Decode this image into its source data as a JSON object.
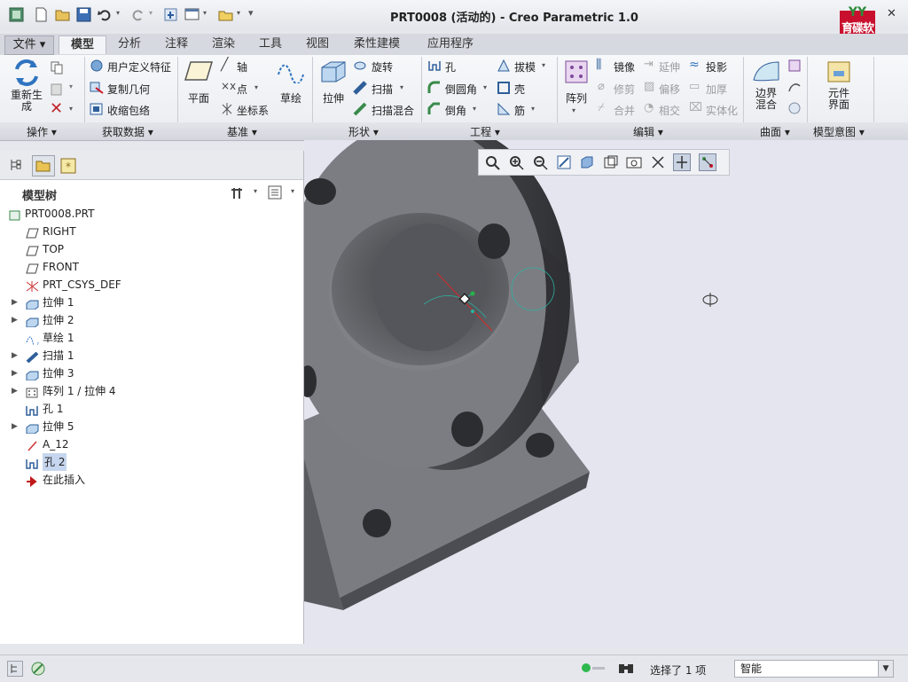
{
  "window": {
    "title": "PRT0008 (活动的) - Creo Parametric 1.0",
    "logo_text": "育碟软件",
    "help_icon": "help-icon"
  },
  "quick_access": [
    "new-file-icon",
    "open-folder-icon",
    "save-icon",
    "undo-icon",
    "redo-icon",
    "regenerate-icon",
    "window-icon",
    "folder-icon",
    "customize-icon"
  ],
  "tabs": [
    {
      "label": "文件",
      "has_menu": true
    },
    {
      "label": "模型",
      "active": true
    },
    {
      "label": "分析"
    },
    {
      "label": "注释"
    },
    {
      "label": "渲染"
    },
    {
      "label": "工具"
    },
    {
      "label": "视图"
    },
    {
      "label": "柔性建模"
    },
    {
      "label": "应用程序"
    }
  ],
  "ribbon": {
    "operations": {
      "regen": "重新生成",
      "group": "操作"
    },
    "get_data": {
      "udf": "用户定义特征",
      "copy_geom": "复制几何",
      "shrinkwrap": "收缩包络",
      "group": "获取数据"
    },
    "datum": {
      "plane": "平面",
      "axis": "轴",
      "point": "点",
      "csys": "坐标系",
      "group": "基准"
    },
    "shapes": {
      "sketch": "草绘",
      "extrude": "拉伸",
      "revolve": "旋转",
      "sweep": "扫描",
      "swept_blend": "扫描混合",
      "group": "形状"
    },
    "engineering": {
      "hole": "孔",
      "round": "倒圆角",
      "chamfer": "倒角",
      "draft": "拔模",
      "shell": "壳",
      "rib": "筋",
      "group": "工程"
    },
    "editing": {
      "pattern": "阵列",
      "mirror": "镜像",
      "trim": "修剪",
      "merge": "合并",
      "extend": "延伸",
      "offset": "偏移",
      "intersect": "相交",
      "project": "投影",
      "thicken": "加厚",
      "solidify": "实体化",
      "group": "编辑"
    },
    "surfaces": {
      "boundary_blend": "边界混合",
      "group": "曲面"
    },
    "model_intent": {
      "component_interface": "元件界面",
      "group": "模型意图"
    }
  },
  "model_tree": {
    "title": "模型树",
    "items": [
      {
        "label": "PRT0008.PRT",
        "icon": "part-icon",
        "expandable": false,
        "indent": 0
      },
      {
        "label": "RIGHT",
        "icon": "datum-plane-icon",
        "expandable": false
      },
      {
        "label": "TOP",
        "icon": "datum-plane-icon",
        "expandable": false
      },
      {
        "label": "FRONT",
        "icon": "datum-plane-icon",
        "expandable": false
      },
      {
        "label": "PRT_CSYS_DEF",
        "icon": "csys-icon",
        "expandable": false
      },
      {
        "label": "拉伸 1",
        "icon": "extrude-icon",
        "expandable": true
      },
      {
        "label": "拉伸 2",
        "icon": "extrude-icon",
        "expandable": true
      },
      {
        "label": "草绘 1",
        "icon": "sketch-icon",
        "expandable": false
      },
      {
        "label": "扫描 1",
        "icon": "sweep-icon",
        "expandable": true
      },
      {
        "label": "拉伸 3",
        "icon": "extrude-icon",
        "expandable": true
      },
      {
        "label": "阵列 1 / 拉伸 4",
        "icon": "pattern-icon",
        "expandable": true
      },
      {
        "label": "孔 1",
        "icon": "hole-icon",
        "expandable": false
      },
      {
        "label": "拉伸 5",
        "icon": "extrude-icon",
        "expandable": true
      },
      {
        "label": "A_12",
        "icon": "datum-axis-icon",
        "expandable": false
      },
      {
        "label": "孔 2",
        "icon": "hole-icon",
        "expandable": false,
        "selected": true
      },
      {
        "label": "在此插入",
        "icon": "insert-here-arrow-icon",
        "expandable": false
      }
    ]
  },
  "status": {
    "selection": "选择了 1 项",
    "filter": "智能"
  },
  "colors": {
    "model_gray": "#7e7f84",
    "viewport_bg": "#e4e5ee",
    "selection_highlight": "#c6d6ee",
    "accent": "#2b6cb0"
  }
}
